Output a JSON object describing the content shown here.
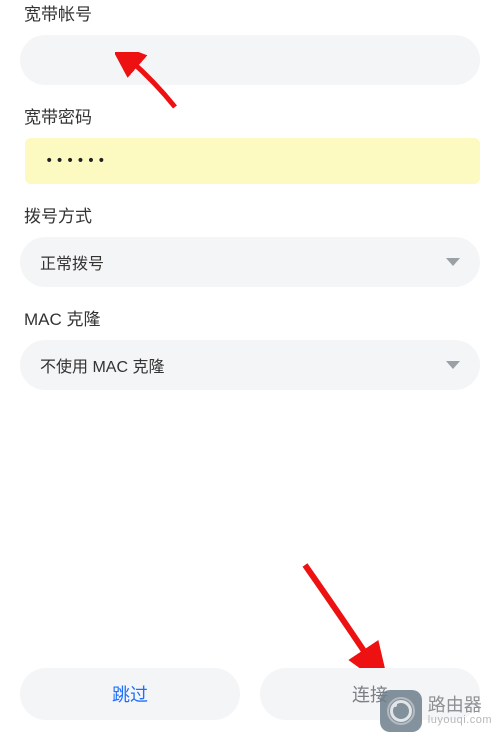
{
  "form": {
    "account_label": "宽带帐号",
    "account_value": "",
    "password_label": "宽带密码",
    "password_masked": "••••••",
    "dial_label": "拨号方式",
    "dial_value": "正常拨号",
    "mac_label": "MAC 克隆",
    "mac_value": "不使用 MAC 克隆"
  },
  "buttons": {
    "skip": "跳过",
    "connect": "连接"
  },
  "watermark": {
    "title": "路由器",
    "sub": "luyouqi.com"
  }
}
